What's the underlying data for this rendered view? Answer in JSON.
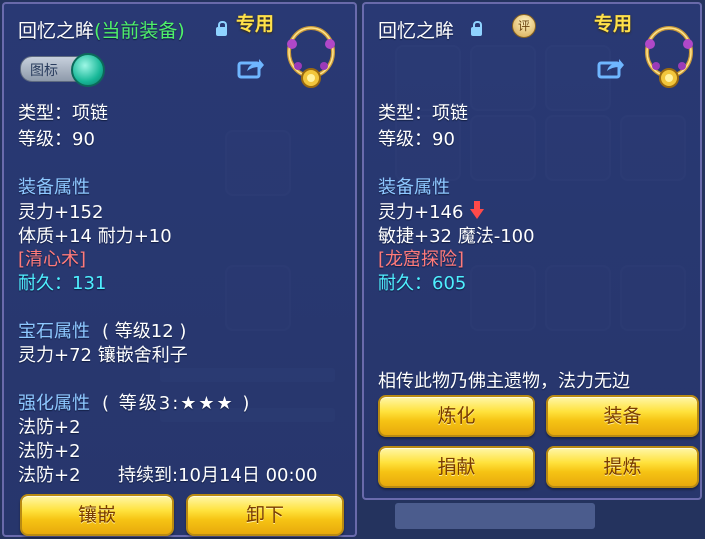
{
  "left_panel": {
    "title": "回忆之眸",
    "title_status": "(当前装备)",
    "exclusive_label": "专用",
    "toggle_label": "图标",
    "type_line": "类型：项链",
    "level_line": "等级：90",
    "attr_heading": "装备属性",
    "attr_lines": [
      "灵力+152",
      "体质+14 耐力+10"
    ],
    "special_skill": "[清心术]",
    "durability": "耐久：131",
    "gem_heading": "宝石属性",
    "gem_level": "( 等级12 )",
    "gem_line": "灵力+72 镶嵌舍利子",
    "enhance_heading": "强化属性",
    "enhance_level": "( 等级3:★★★ )",
    "enhance_lines": [
      "法防+2",
      "法防+2",
      "法防+2"
    ],
    "duration": "持续到:10月14日 00:00",
    "buttons": {
      "inlay": "镶嵌",
      "unequip": "卸下"
    }
  },
  "right_panel": {
    "title": "回忆之眸",
    "rate_badge": "评",
    "exclusive_label": "专用",
    "type_line": "类型：项链",
    "level_line": "等级：90",
    "attr_heading": "装备属性",
    "attr_lines": [
      "灵力+146",
      "敏捷+32 魔法-100"
    ],
    "special_skill": "[龙窟探险]",
    "durability": "耐久：605",
    "description": "相传此物乃佛主遗物，法力无边",
    "buttons": {
      "refine": "炼化",
      "equip": "装备",
      "donate": "捐献",
      "extract": "提炼"
    }
  },
  "colors": {
    "panel_bg": "#2a3a76",
    "heading": "#8ec8ff",
    "current_equip": "#4ff06a",
    "special": "#ff7b7b",
    "durability": "#4ff0ff",
    "exclusive": "#ffe14a",
    "button": "#ffe23d"
  }
}
